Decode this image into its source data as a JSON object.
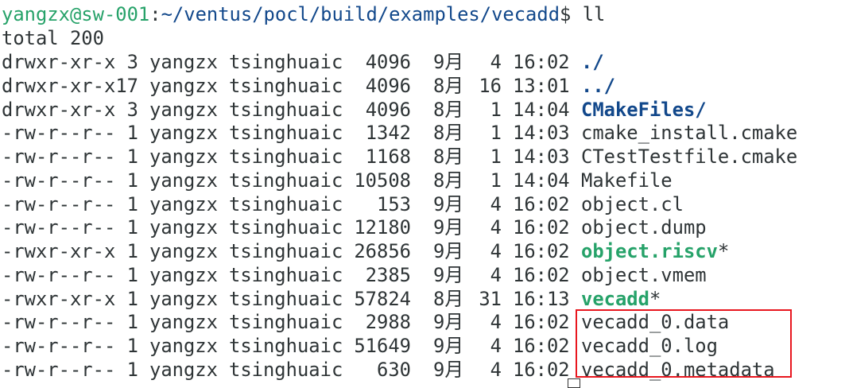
{
  "prompt": {
    "user_host": "yangzx@sw-001",
    "sep": ":",
    "path": "~/ventus/pocl/build/examples/vecadd",
    "symbol": "$",
    "command": " ll"
  },
  "total": "total 200",
  "colors": {
    "prompt_user": "#26a269",
    "prompt_path": "#12488b",
    "directory": "#12488b",
    "executable": "#26a269",
    "highlight_box": "#e8161e"
  },
  "rows": [
    {
      "perm": "drwxr-xr-x",
      "links": "3",
      "user": "yangzx",
      "group": "tsinghuaic",
      "size": "4096",
      "month": "9月",
      "day": "4",
      "time": "16:02",
      "name": "./",
      "type": "dir"
    },
    {
      "perm": "drwxr-xr-x",
      "links": "17",
      "user": "yangzx",
      "group": "tsinghuaic",
      "size": "4096",
      "month": "8月",
      "day": "16",
      "time": "13:01",
      "name": "../",
      "type": "dir"
    },
    {
      "perm": "drwxr-xr-x",
      "links": "3",
      "user": "yangzx",
      "group": "tsinghuaic",
      "size": "4096",
      "month": "8月",
      "day": "1",
      "time": "14:04",
      "name": "CMakeFiles/",
      "type": "dir"
    },
    {
      "perm": "-rw-r--r--",
      "links": "1",
      "user": "yangzx",
      "group": "tsinghuaic",
      "size": "1342",
      "month": "8月",
      "day": "1",
      "time": "14:03",
      "name": "cmake_install.cmake",
      "type": "file"
    },
    {
      "perm": "-rw-r--r--",
      "links": "1",
      "user": "yangzx",
      "group": "tsinghuaic",
      "size": "1168",
      "month": "8月",
      "day": "1",
      "time": "14:03",
      "name": "CTestTestfile.cmake",
      "type": "file"
    },
    {
      "perm": "-rw-r--r--",
      "links": "1",
      "user": "yangzx",
      "group": "tsinghuaic",
      "size": "10508",
      "month": "8月",
      "day": "1",
      "time": "14:04",
      "name": "Makefile",
      "type": "file"
    },
    {
      "perm": "-rw-r--r--",
      "links": "1",
      "user": "yangzx",
      "group": "tsinghuaic",
      "size": "153",
      "month": "9月",
      "day": "4",
      "time": "16:02",
      "name": "object.cl",
      "type": "file"
    },
    {
      "perm": "-rw-r--r--",
      "links": "1",
      "user": "yangzx",
      "group": "tsinghuaic",
      "size": "12180",
      "month": "9月",
      "day": "4",
      "time": "16:02",
      "name": "object.dump",
      "type": "file"
    },
    {
      "perm": "-rwxr-xr-x",
      "links": "1",
      "user": "yangzx",
      "group": "tsinghuaic",
      "size": "26856",
      "month": "9月",
      "day": "4",
      "time": "16:02",
      "name": "object.riscv*",
      "type": "exe"
    },
    {
      "perm": "-rw-r--r--",
      "links": "1",
      "user": "yangzx",
      "group": "tsinghuaic",
      "size": "2385",
      "month": "9月",
      "day": "4",
      "time": "16:02",
      "name": "object.vmem",
      "type": "file"
    },
    {
      "perm": "-rwxr-xr-x",
      "links": "1",
      "user": "yangzx",
      "group": "tsinghuaic",
      "size": "57824",
      "month": "8月",
      "day": "31",
      "time": "16:13",
      "name": "vecadd*",
      "type": "exe"
    },
    {
      "perm": "-rw-r--r--",
      "links": "1",
      "user": "yangzx",
      "group": "tsinghuaic",
      "size": "2988",
      "month": "9月",
      "day": "4",
      "time": "16:02",
      "name": "vecadd_0.data",
      "type": "file"
    },
    {
      "perm": "-rw-r--r--",
      "links": "1",
      "user": "yangzx",
      "group": "tsinghuaic",
      "size": "51649",
      "month": "9月",
      "day": "4",
      "time": "16:02",
      "name": "vecadd_0.log",
      "type": "file"
    },
    {
      "perm": "-rw-r--r--",
      "links": "1",
      "user": "yangzx",
      "group": "tsinghuaic",
      "size": "630",
      "month": "9月",
      "day": "4",
      "time": "16:02",
      "name": "vecadd_0.metadata",
      "type": "file"
    }
  ]
}
